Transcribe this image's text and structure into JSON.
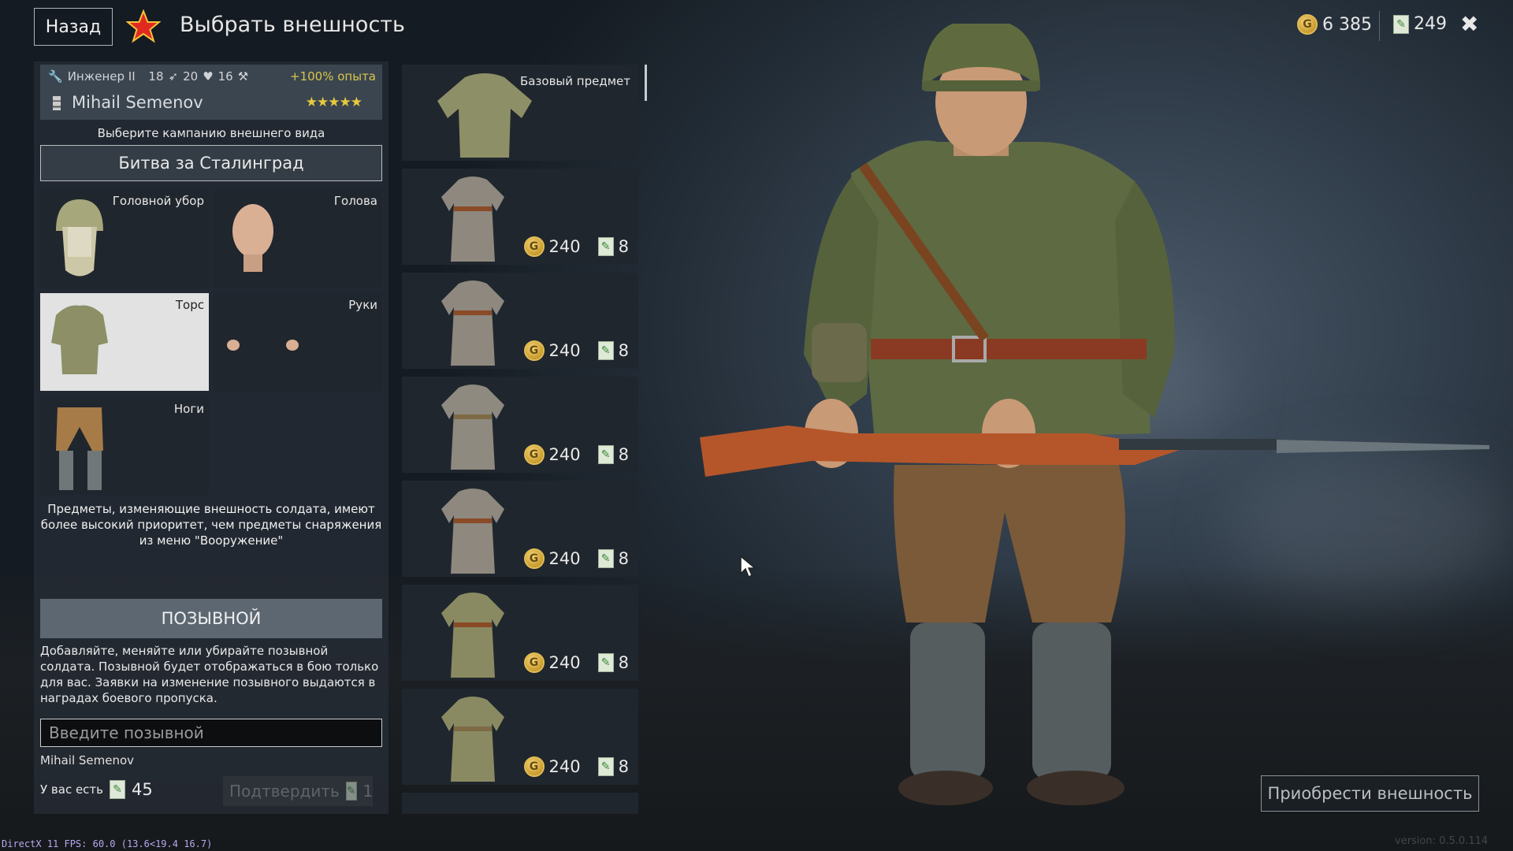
{
  "header": {
    "back_label": "Назад",
    "title": "Выбрать внешность",
    "gold": "6 385",
    "tickets": "249"
  },
  "soldier": {
    "class": "Инженер II",
    "stat1": "18",
    "stat2": "20",
    "stat3": "16",
    "exp_bonus": "+100% опыта",
    "name": "Mihail Semenov",
    "stars": "★★★★★"
  },
  "campaign": {
    "hint": "Выберите кампанию внешнего вида",
    "selected": "Битва за Сталинград"
  },
  "slots": [
    {
      "label": "Головной убор",
      "icon": "helmet-icon"
    },
    {
      "label": "Голова",
      "icon": "head-icon"
    },
    {
      "label": "Торс",
      "icon": "torso-icon",
      "selected": true
    },
    {
      "label": "Руки",
      "icon": "hands-icon"
    },
    {
      "label": "Ноги",
      "icon": "legs-icon"
    }
  ],
  "info_text": "Предметы, изменяющие внешность солдата, имеют более высокий приоритет, чем предметы снаряжения из меню \"Вооружение\"",
  "callsign": {
    "header": "ПОЗЫВНОЙ",
    "description": "Добавляйте, меняйте или убирайте позывной солдата. Позывной будет отображаться в бою только для вас. Заявки на изменение позывного выдаются в наградах боевого пропуска.",
    "placeholder": "Введите позывной",
    "current": "Mihail Semenov",
    "have_label": "У вас есть",
    "have_count": "45",
    "confirm_label": "Подтвердить",
    "confirm_cost": "1"
  },
  "items": [
    {
      "label": "Базовый предмет",
      "icon": "tunic-icon"
    },
    {
      "price_gold": "240",
      "price_tickets": "8",
      "icon": "coat-icon"
    },
    {
      "price_gold": "240",
      "price_tickets": "8",
      "icon": "coat-icon"
    },
    {
      "price_gold": "240",
      "price_tickets": "8",
      "icon": "coat-icon"
    },
    {
      "price_gold": "240",
      "price_tickets": "8",
      "icon": "coat-icon"
    },
    {
      "price_gold": "240",
      "price_tickets": "8",
      "icon": "coat-icon"
    },
    {
      "price_gold": "240",
      "price_tickets": "8",
      "icon": "coat-icon"
    }
  ],
  "buy_label": "Приобрести внешность",
  "fps_text": "DirectX 11 FPS: 60.0 (13.6<19.4 16.7)",
  "version_text": "version: 0.5.0.114",
  "colors": {
    "accent_gold": "#e7c93e",
    "selected_slot": "#e2e2e2",
    "panel": "#262c34"
  }
}
